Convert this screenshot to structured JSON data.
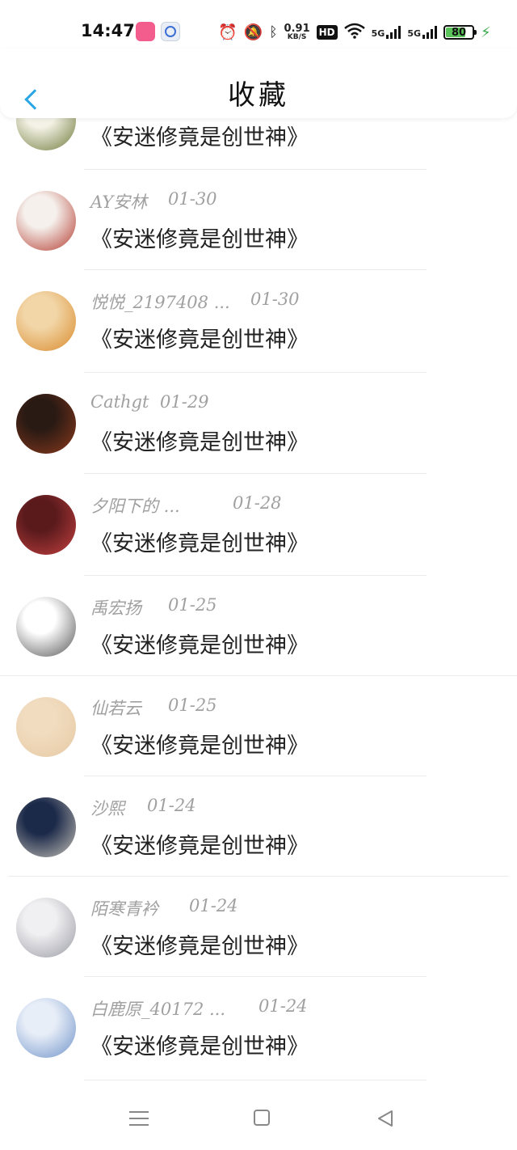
{
  "status_bar": {
    "time": "14:47",
    "net_speed_value": "0.91",
    "net_speed_unit": "KB/S",
    "hd_label": "HD",
    "sim1_label": "5G",
    "sim2_label": "5G",
    "battery_level": "80",
    "battery_fraction": 0.8,
    "icons": [
      "bilibili-app-icon",
      "app-icon",
      "alarm-icon",
      "mute-icon",
      "bluetooth-icon",
      "wifi-icon",
      "signal-icon",
      "charging-icon"
    ]
  },
  "header": {
    "title": "收藏",
    "accent_color": "#2aa6e6"
  },
  "items": [
    {
      "user": "",
      "date": "",
      "text": "《安迷修竟是创世神》",
      "avatar_colors": [
        "#f4f2e6",
        "#6f7a3a"
      ]
    },
    {
      "user": "AY安林",
      "date": "01-30",
      "text": "《安迷修竟是创世神》",
      "avatar_colors": [
        "#f5f0ec",
        "#b33a2e"
      ]
    },
    {
      "user": "悦悦_2197408 ...",
      "date": "01-30",
      "text": "《安迷修竟是创世神》",
      "avatar_colors": [
        "#f2d6a8",
        "#d98a2b"
      ]
    },
    {
      "user": "Cathgt",
      "date": "01-29",
      "text": "《安迷修竟是创世神》",
      "avatar_colors": [
        "#2a1a14",
        "#8c3a1c"
      ]
    },
    {
      "user": "夕阳下的 ...",
      "date": "01-28",
      "text": "《安迷修竟是创世神》",
      "avatar_colors": [
        "#5a1a1c",
        "#c44040"
      ]
    },
    {
      "user": "禹宏扬",
      "date": "01-25",
      "text": "《安迷修竟是创世神》",
      "avatar_colors": [
        "#ffffff",
        "#555555"
      ]
    },
    {
      "user": "仙若云",
      "date": "01-25",
      "text": "《安迷修竟是创世神》",
      "avatar_colors": [
        "#f1dcc0",
        "#e6c9a3"
      ]
    },
    {
      "user": "沙熙",
      "date": "01-24",
      "text": "《安迷修竟是创世神》",
      "avatar_colors": [
        "#1c2a4a",
        "#c6c2b8"
      ]
    },
    {
      "user": "陌寒青衿",
      "date": "01-24",
      "text": "《安迷修竟是创世神》",
      "avatar_colors": [
        "#f0f0f2",
        "#9a9aa4"
      ]
    },
    {
      "user": "白鹿原_40172 ...",
      "date": "01-24",
      "text": "《安迷修竟是创世神》",
      "avatar_colors": [
        "#e8eef8",
        "#6f93c9"
      ]
    }
  ],
  "nav_bar": {
    "icons": [
      "menu-icon",
      "home-icon",
      "back-icon"
    ]
  }
}
